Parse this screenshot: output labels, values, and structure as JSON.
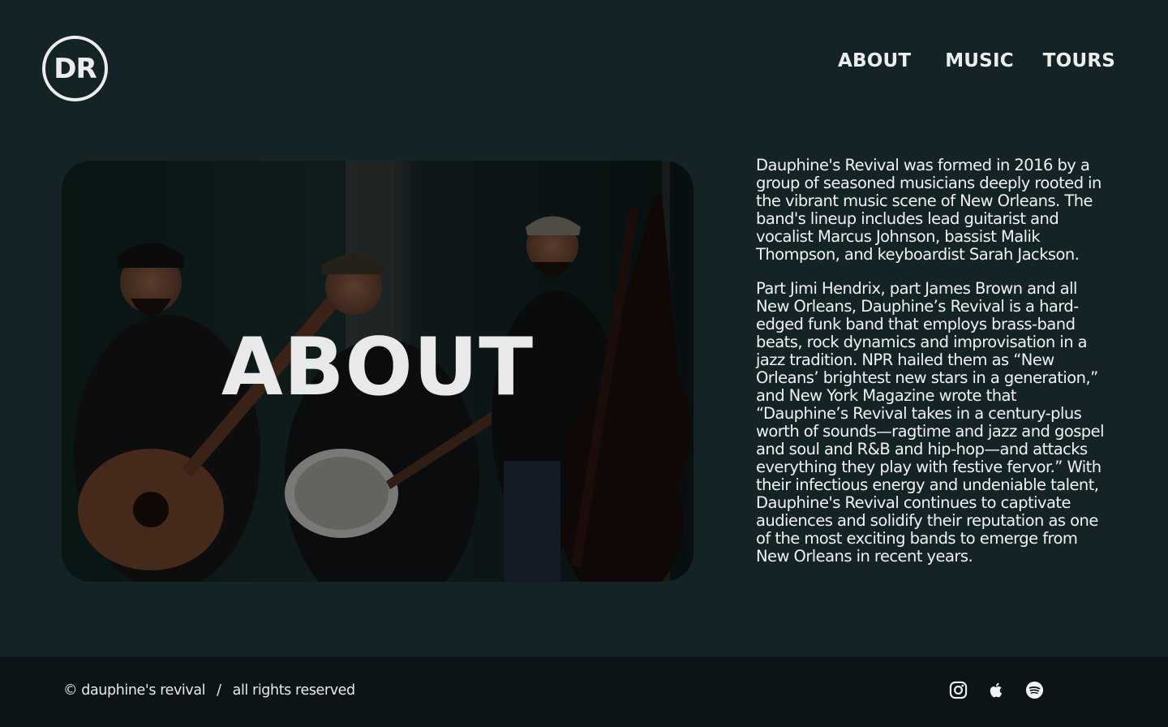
{
  "logo": {
    "text": "DR"
  },
  "nav": {
    "about": "ABOUT",
    "music": "MUSIC",
    "tours": "TOURS"
  },
  "hero": {
    "title": "ABOUT"
  },
  "about": {
    "paragraphs": [
      "Dauphine's Revival was formed in 2016 by a group of seasoned musicians deeply rooted in the vibrant music scene of New Orleans. The band's lineup includes lead guitarist and vocalist Marcus Johnson, bassist Malik Thompson, and keyboardist Sarah Jackson.",
      "Part Jimi Hendrix, part James Brown and all New Orleans, Dauphine’s Revival is a hard-edged funk band that employs brass-band beats, rock dynamics and improvisation in a jazz tradition. NPR hailed them as “New Orleans’ brightest new stars in a generation,” and New York Magazine wrote that “Dauphine’s Revival takes in a century-plus worth of sounds—ragtime and jazz and gospel and soul and R&B and hip-hop—and attacks everything they play with festive fervor.” With their infectious energy and undeniable talent, Dauphine's Revival continues to captivate audiences and solidify their reputation as one of the most exciting bands to emerge from New Orleans in recent years."
    ]
  },
  "footer": {
    "copyright": "© dauphine's revival",
    "separator": "/",
    "rights": "all rights reserved",
    "socials": [
      "instagram-icon",
      "apple-icon",
      "spotify-icon"
    ]
  },
  "colors": {
    "background": "#142426",
    "footer": "#0c1416",
    "text": "#f0f0f0"
  }
}
